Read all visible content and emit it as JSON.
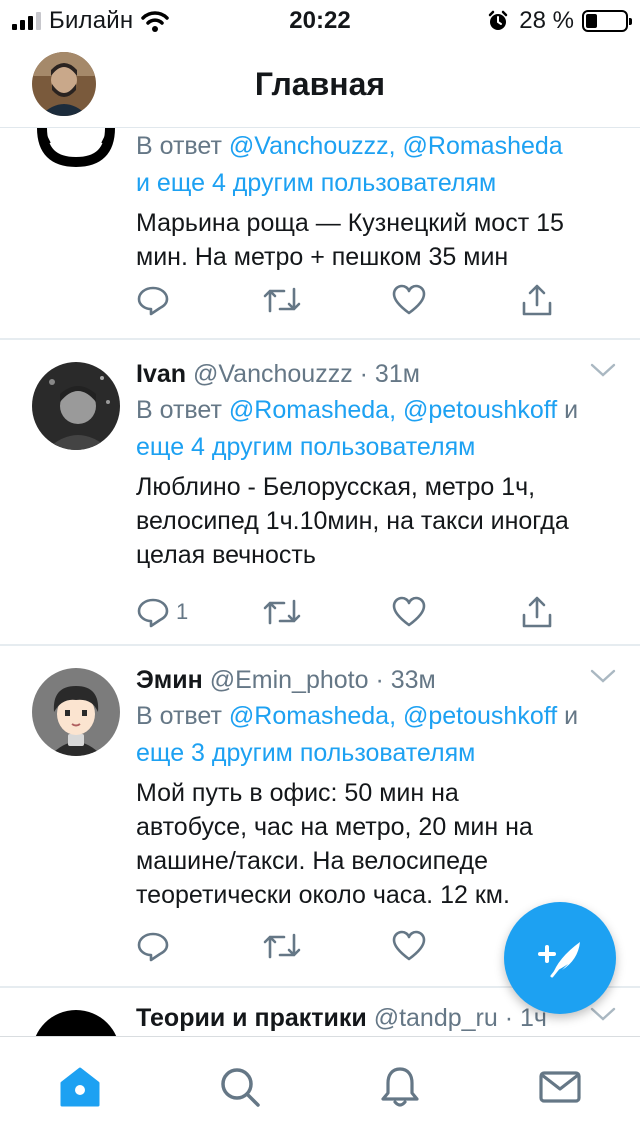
{
  "status_bar": {
    "carrier": "Билайн",
    "time": "20:22",
    "battery_percent": "28 %",
    "battery_level": 0.28
  },
  "header": {
    "title": "Главная",
    "avatar_icon": "user-avatar"
  },
  "tweets": [
    {
      "name": "",
      "handle": "",
      "time": "",
      "reply_prefix": "В ответ",
      "reply_mentions": "@Vanchouzzz, @Romasheda",
      "reply_more": "и еще 4 другим пользователям",
      "text_lines": [
        "Марьина роща — Кузнецкий мост 15",
        "мин. На метро + пешком 35 мин"
      ],
      "reply_count": ""
    },
    {
      "name": "Ivan",
      "handle": "@Vanchouzzz",
      "time": "31м",
      "reply_prefix": "В ответ",
      "reply_mentions": "@Romasheda, @petoushkoff",
      "reply_and": "и",
      "reply_more": "еще 4 другим пользователям",
      "text_lines": [
        "Люблино - Белорусская, метро 1ч,",
        "велосипед 1ч.10мин, на такси иногда",
        "целая вечность"
      ],
      "reply_count": "1"
    },
    {
      "name": "Эмин",
      "handle": "@Emin_photo",
      "time": "33м",
      "reply_prefix": "В ответ",
      "reply_mentions": "@Romasheda, @petoushkoff",
      "reply_and": "и",
      "reply_more": "еще 3 другим пользователям",
      "text_lines": [
        "Мой путь в офис: 50 мин на",
        "автобусе, час на метро, 20 мин на",
        "машине/такси. На велосипеде",
        "теоретически около часа. 12 км."
      ],
      "reply_count": ""
    },
    {
      "name": "Теории и практики",
      "handle": "@tandp_ru",
      "time": "1ч"
    }
  ],
  "colors": {
    "accent": "#1da1f2",
    "secondary_text": "#657786",
    "divider": "#e6ecf0"
  },
  "tabs": [
    {
      "icon": "home-icon",
      "active": true
    },
    {
      "icon": "search-icon",
      "active": false
    },
    {
      "icon": "bell-icon",
      "active": false
    },
    {
      "icon": "mail-icon",
      "active": false
    }
  ]
}
